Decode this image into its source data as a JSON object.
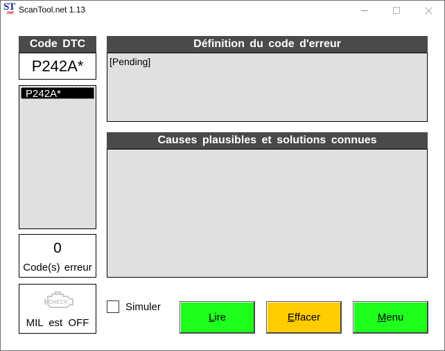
{
  "window": {
    "title": "ScanTool.net 1.13",
    "icon_text_main": "ST",
    "icon_text_sub": ".net"
  },
  "left": {
    "code_header": "Code DTC",
    "current_code": "P242A*",
    "code_list": [
      "P242A*"
    ],
    "error_count": "0",
    "error_count_label": "Code(s) erreur",
    "mil_status": "MIL est OFF",
    "check_engine_text": "CHECK"
  },
  "definition": {
    "header": "Définition du code d'erreur",
    "text": "[Pending]"
  },
  "causes": {
    "header": "Causes plausibles et solutions connues",
    "text": ""
  },
  "controls": {
    "simulate_label": "Simuler",
    "simulate_checked": false,
    "read": {
      "accel": "L",
      "rest": "ire"
    },
    "clear": {
      "accel": "E",
      "rest": "ffacer"
    },
    "menu": {
      "accel": "M",
      "rest": "enu"
    }
  },
  "colors": {
    "header_bg": "#4a4a4a",
    "panel_bg": "#e0e0e0",
    "button_green": "#1eff1e",
    "button_yellow": "#ffcc00"
  }
}
